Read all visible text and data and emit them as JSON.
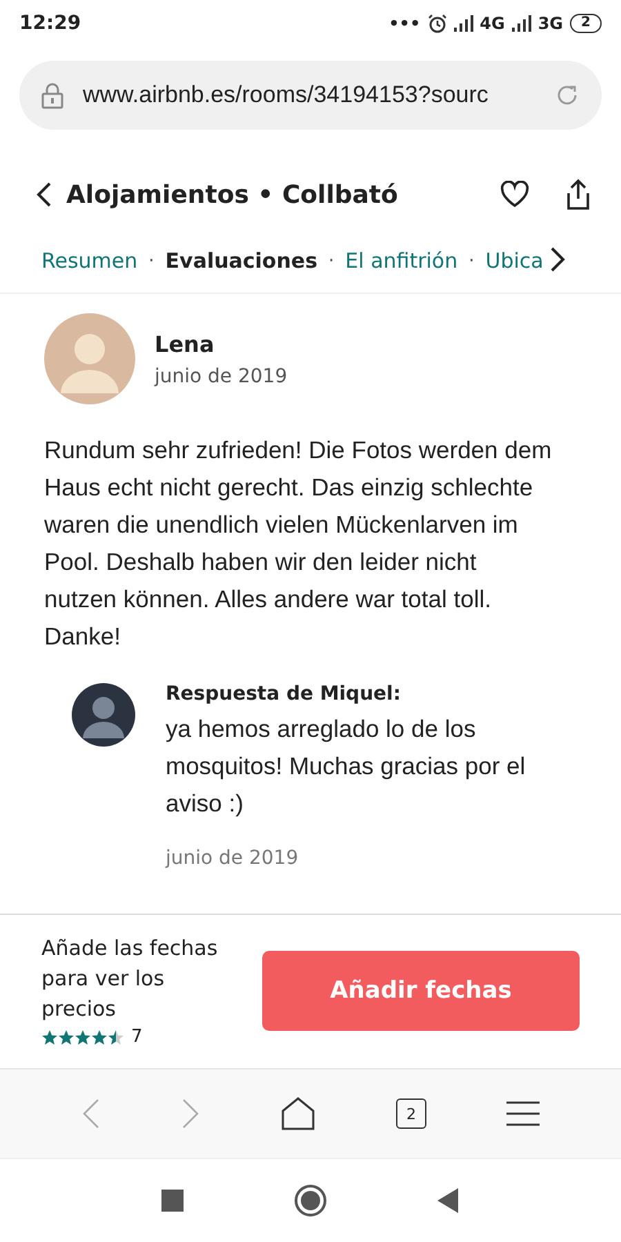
{
  "status_bar": {
    "time": "12:29",
    "dots": "•••",
    "network_1": "4G",
    "network_2": "3G",
    "battery": "2"
  },
  "address_bar": {
    "url": "www.airbnb.es/rooms/34194153?sourc"
  },
  "header": {
    "title": "Alojamientos • Collbató"
  },
  "tabs": [
    {
      "label": "Resumen",
      "selected": false
    },
    {
      "separator": "·",
      "label": "Evaluaciones",
      "selected": true
    },
    {
      "separator": "·",
      "label": "El anfitrión",
      "selected": false
    },
    {
      "separator": "·",
      "label": "Ubica",
      "selected": false
    }
  ],
  "review": {
    "author": "Lena",
    "date": "junio de 2019",
    "text": "Rundum sehr zufrieden! Die Fotos werden dem Haus echt nicht gerecht. Das einzig schlechte waren die unendlich vielen Mückenlarven im Pool. Deshalb haben wir den leider nicht nutzen können. Alles andere war total toll. Danke!",
    "response": {
      "heading": "Respuesta de Miquel:",
      "text": "ya hemos arreglado lo de los mosquitos! Muchas gracias por el aviso :)",
      "date": "junio de 2019"
    }
  },
  "booking_bar": {
    "prompt": "Añade las fechas para ver los precios",
    "stars": 4.5,
    "review_count": "7",
    "button": "Añadir fechas"
  },
  "browser_toolbar": {
    "tab_count": "2"
  }
}
